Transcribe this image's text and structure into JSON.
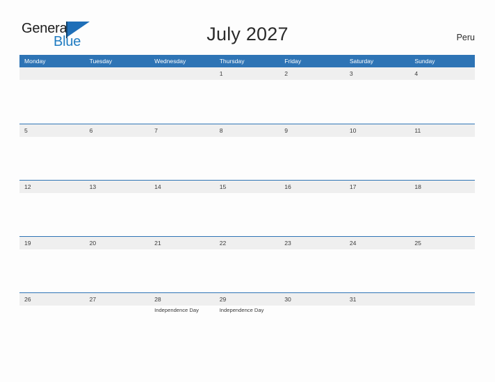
{
  "logo": {
    "word1": "General",
    "word2": "Blue",
    "flag_color": "#1f6fb8",
    "word2_color": "#1f7bc1"
  },
  "header": {
    "title": "July 2027",
    "country": "Peru"
  },
  "theme": {
    "header_blue": "#2e74b5",
    "band_gray": "#efefef",
    "page_background": "#fdfdfd",
    "text_color": "#3a3a3a"
  },
  "calendar": {
    "month": "July",
    "year": "2027",
    "weekday_labels": [
      "Monday",
      "Tuesday",
      "Wednesday",
      "Thursday",
      "Friday",
      "Saturday",
      "Sunday"
    ],
    "weeks": [
      [
        {
          "day": "",
          "events": []
        },
        {
          "day": "",
          "events": []
        },
        {
          "day": "",
          "events": []
        },
        {
          "day": "1",
          "events": []
        },
        {
          "day": "2",
          "events": []
        },
        {
          "day": "3",
          "events": []
        },
        {
          "day": "4",
          "events": []
        }
      ],
      [
        {
          "day": "5",
          "events": []
        },
        {
          "day": "6",
          "events": []
        },
        {
          "day": "7",
          "events": []
        },
        {
          "day": "8",
          "events": []
        },
        {
          "day": "9",
          "events": []
        },
        {
          "day": "10",
          "events": []
        },
        {
          "day": "11",
          "events": []
        }
      ],
      [
        {
          "day": "12",
          "events": []
        },
        {
          "day": "13",
          "events": []
        },
        {
          "day": "14",
          "events": []
        },
        {
          "day": "15",
          "events": []
        },
        {
          "day": "16",
          "events": []
        },
        {
          "day": "17",
          "events": []
        },
        {
          "day": "18",
          "events": []
        }
      ],
      [
        {
          "day": "19",
          "events": []
        },
        {
          "day": "20",
          "events": []
        },
        {
          "day": "21",
          "events": []
        },
        {
          "day": "22",
          "events": []
        },
        {
          "day": "23",
          "events": []
        },
        {
          "day": "24",
          "events": []
        },
        {
          "day": "25",
          "events": []
        }
      ],
      [
        {
          "day": "26",
          "events": []
        },
        {
          "day": "27",
          "events": []
        },
        {
          "day": "28",
          "events": [
            "Independence Day"
          ]
        },
        {
          "day": "29",
          "events": [
            "Independence Day"
          ]
        },
        {
          "day": "30",
          "events": []
        },
        {
          "day": "31",
          "events": []
        },
        {
          "day": "",
          "events": []
        }
      ]
    ]
  }
}
